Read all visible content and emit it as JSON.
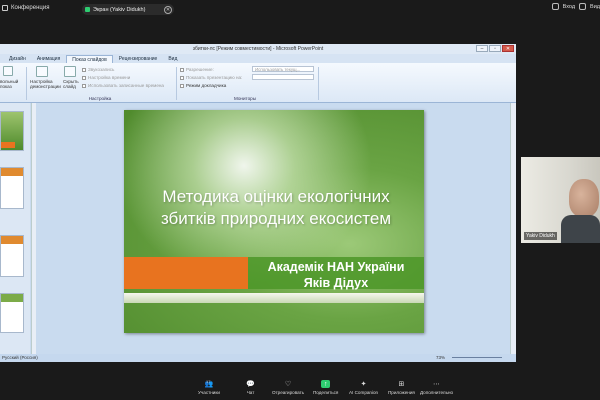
{
  "zoom_top": {
    "conference_label": "Конференция",
    "share_label": "Экран (Yakiv Didukh)",
    "exit_label": "Вход",
    "view_label": "Вид"
  },
  "ppt": {
    "window_title": "збитки-лс [Режим совместимости] - Microsoft PowerPoint",
    "tabs": [
      "Дизайн",
      "Анимация",
      "Показ слайдов",
      "Рецензирование",
      "Вид"
    ],
    "active_tab": "Показ слайдов",
    "ribbon": {
      "btn_slideshow_setup": "вольный\nпоказ",
      "btn_demonstration_setup": "Настройка\nдемонстрации",
      "btn_hide_slide": "Скрыть\nслайд",
      "record_narration": "Звукозапись",
      "rehearse_timings": "Настройка времени",
      "use_timings": "Использовать записанные времена",
      "group_setup": "Настройка",
      "resolution_label": "Разрешение:",
      "resolution_value": "Использовать текущ...",
      "show_on_label": "Показать презентацию на:",
      "presenter_view": "Режим докладчика",
      "group_monitors": "Мониторы"
    },
    "status_language": "Русский (Россия)",
    "zoom_level": "73%"
  },
  "slide": {
    "title": "Методика оцінки екологічних збитків природних екосистем",
    "author_line1": "Академік НАН України",
    "author_line2": "Яків Дідух"
  },
  "video": {
    "participant_name": "Yakiv Didukh"
  },
  "zoom_bottom": {
    "participants_label": "Участники",
    "participants_count": "17",
    "chat_label": "Чат",
    "react_label": "Отреагировать",
    "share_label": "Поделиться",
    "ai_label": "AI Companion",
    "apps_label": "Приложения",
    "more_label": "Дополнительно"
  },
  "colors": {
    "share_green": "#2ecc71",
    "slide_orange": "#e8731f",
    "slide_green": "#4c9628"
  }
}
